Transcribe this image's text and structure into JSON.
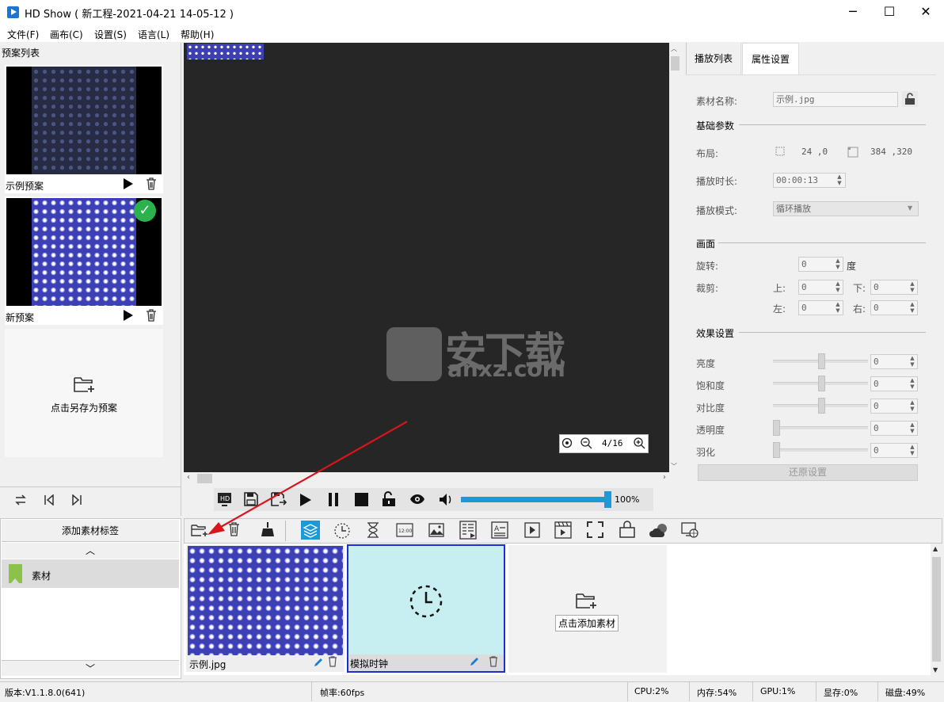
{
  "window": {
    "title": "HD Show ( 新工程-2021-04-21 14-05-12 )",
    "minimize": "─",
    "maximize": "☐",
    "close": "✕"
  },
  "menu": [
    "文件(F)",
    "画布(C)",
    "设置(S)",
    "语言(L)",
    "帮助(H)"
  ],
  "presets": {
    "header": "预案列表",
    "items": [
      {
        "label": "示例预案",
        "active": false
      },
      {
        "label": "新预案",
        "active": true
      }
    ],
    "save_as": "点击另存为预案"
  },
  "canvas": {
    "zoom_page": "4/16",
    "volume": "100%",
    "volume_level": 1.0
  },
  "watermark": {
    "text": "安下载",
    "sub": "anxz.com"
  },
  "right": {
    "tabs": [
      "播放列表",
      "属性设置"
    ],
    "active_tab": "属性设置",
    "name_label": "素材名称:",
    "name_value": "示例.jpg",
    "basic_section": "基础参数",
    "layout_label": "布局:",
    "layout_pos": "24 ,0",
    "layout_size": "384 ,320",
    "duration_label": "播放时长:",
    "duration_value": "00:00:13",
    "mode_label": "播放模式:",
    "mode_value": "循环播放",
    "picture_section": "画面",
    "rotate_label": "旋转:",
    "rotate_value": "0",
    "rotate_unit": "度",
    "crop_label": "裁剪:",
    "crop_top_label": "上:",
    "crop_top": "0",
    "crop_bottom_label": "下:",
    "crop_bottom": "0",
    "crop_left_label": "左:",
    "crop_left": "0",
    "crop_right_label": "右:",
    "crop_right": "0",
    "effects_section": "效果设置",
    "brightness_label": "亮度",
    "brightness": "0",
    "saturation_label": "饱和度",
    "saturation": "0",
    "contrast_label": "对比度",
    "contrast": "0",
    "opacity_label": "透明度",
    "opacity": "0",
    "feather_label": "羽化",
    "feather": "0",
    "reset": "还原设置"
  },
  "library": {
    "add_tag": "添加素材标签",
    "up_arrow": "︿",
    "down_arrow": "﹀",
    "tag": "素材",
    "items": [
      {
        "label": "示例.jpg"
      },
      {
        "label": "模拟时钟"
      }
    ],
    "add_media": "点击添加素材"
  },
  "status": {
    "version": "版本:V1.1.8.0(641)",
    "fps": "帧率:60fps",
    "cpu": "CPU:2%",
    "memory": "内存:54%",
    "gpu": "GPU:1%",
    "vram": "显存:0%",
    "disk": "磁盘:49%"
  },
  "colors": {
    "accent": "#1a9ad8",
    "selected_border": "#1c2fd0",
    "check_green": "#2bb24c",
    "annotation_arrow": "#d9151b"
  }
}
